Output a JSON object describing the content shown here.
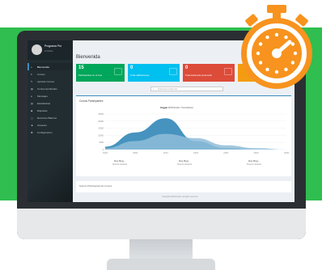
{
  "colors": {
    "background_green": "#2fbe4f",
    "sidebar": "#222d32",
    "accent_blue": "#3c8dbc",
    "box_green": "#00a65a",
    "box_cyan": "#00c0ef",
    "box_red": "#dd4b39",
    "box_orange": "#f39c12",
    "stopwatch_orange": "#f7931e"
  },
  "sidebar": {
    "user_name": "Programa Pró",
    "user_status": "● Online",
    "items": [
      {
        "icon": "home-icon",
        "label": "Bienvenida"
      },
      {
        "icon": "list-icon",
        "label": "Cursos"
      },
      {
        "icon": "pencil-icon",
        "label": "Aprobar Cursos"
      },
      {
        "icon": "book-icon",
        "label": "Cursos Aprobados"
      },
      {
        "icon": "users-icon",
        "label": "Mensajes"
      },
      {
        "icon": "chart-icon",
        "label": "Estadísticas"
      },
      {
        "icon": "tag-icon",
        "label": "Etiquetas"
      },
      {
        "icon": "doc-icon",
        "label": "Recursos Básicos"
      },
      {
        "icon": "user-icon",
        "label": "Usuarios"
      },
      {
        "icon": "gear-icon",
        "label": "Configuración"
      }
    ]
  },
  "main": {
    "page_title": "Bienvenida",
    "boxes": [
      {
        "value": "15",
        "label": "Participantes en el mes"
      },
      {
        "value": "0",
        "label": "Total calificaciones"
      },
      {
        "value": "0",
        "label": "Total asistencia presencial"
      },
      {
        "value": "",
        "label": ""
      }
    ],
    "search_placeholder": "Seleccionar Asistencia",
    "panel_title": "Cursos Participantes",
    "panel_subtitle_bold": "Hoggar",
    "panel_subtitle": "AIPSchooler / Consultorías",
    "stats": [
      {
        "value": "Hoy Reg...",
        "label": "Nuevos Usuarios"
      },
      {
        "value": "Hoy Reg...",
        "label": "Nuevos Usuarios"
      },
      {
        "value": "Hoy Reg...",
        "label": "Nuevos Usuarios"
      }
    ],
    "panel2_title": "Nuevos Participantes En Cursos",
    "footer": "Copyright AIPSchooler. All rights reserved."
  },
  "chart_data": {
    "type": "area",
    "x": [
      "01/04",
      "06/04",
      "11/04",
      "16/04",
      "21/04",
      "26/04",
      "01/05"
    ],
    "series": [
      {
        "values": [
          2,
          12,
          22,
          6,
          1,
          0,
          0
        ]
      },
      {
        "values": [
          1,
          6,
          11,
          8,
          3,
          1,
          0
        ]
      }
    ],
    "y_ticks": [
      "25000",
      "20000",
      "15000",
      "10000",
      "5000",
      "0"
    ],
    "ylim": [
      0,
      25
    ]
  }
}
